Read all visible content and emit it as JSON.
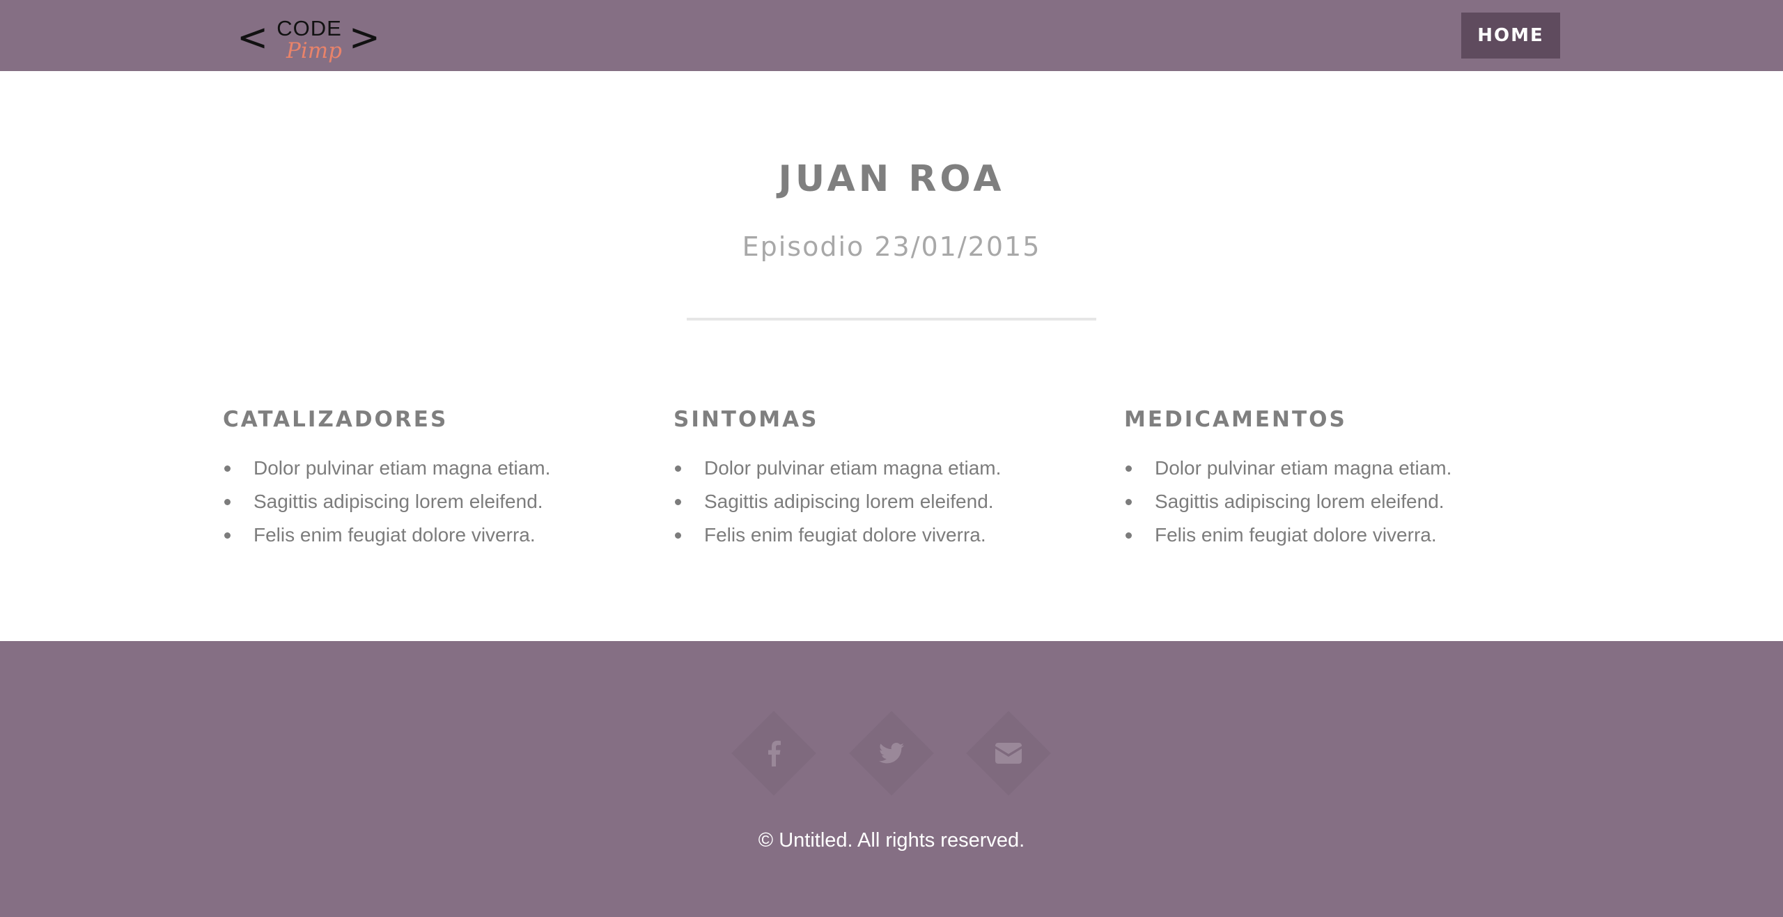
{
  "header": {
    "logo": {
      "bracket_left": "<",
      "code": "CODE",
      "pimp": "Pimp",
      "bracket_right": ">"
    },
    "nav": {
      "home_label": "HOME"
    }
  },
  "main": {
    "title": "JUAN ROA",
    "subtitle": "Episodio 23/01/2015",
    "columns": [
      {
        "heading": "CATALIZADORES",
        "items": [
          "Dolor pulvinar etiam magna etiam.",
          "Sagittis adipiscing lorem eleifend.",
          "Felis enim feugiat dolore viverra."
        ]
      },
      {
        "heading": "SINTOMAS",
        "items": [
          "Dolor pulvinar etiam magna etiam.",
          "Sagittis adipiscing lorem eleifend.",
          "Felis enim feugiat dolore viverra."
        ]
      },
      {
        "heading": "MEDICAMENTOS",
        "items": [
          "Dolor pulvinar etiam magna etiam.",
          "Sagittis adipiscing lorem eleifend.",
          "Felis enim feugiat dolore viverra."
        ]
      }
    ]
  },
  "footer": {
    "social": [
      {
        "icon": "facebook-icon"
      },
      {
        "icon": "twitter-icon"
      },
      {
        "icon": "envelope-icon"
      }
    ],
    "copyright": "© Untitled. All rights reserved."
  },
  "colors": {
    "header_bg": "#856f84",
    "nav_button_bg": "#5f4b5e",
    "logo_accent": "#e9836a",
    "heading_text": "#7f7f7f",
    "footer_bg": "#856f84"
  }
}
